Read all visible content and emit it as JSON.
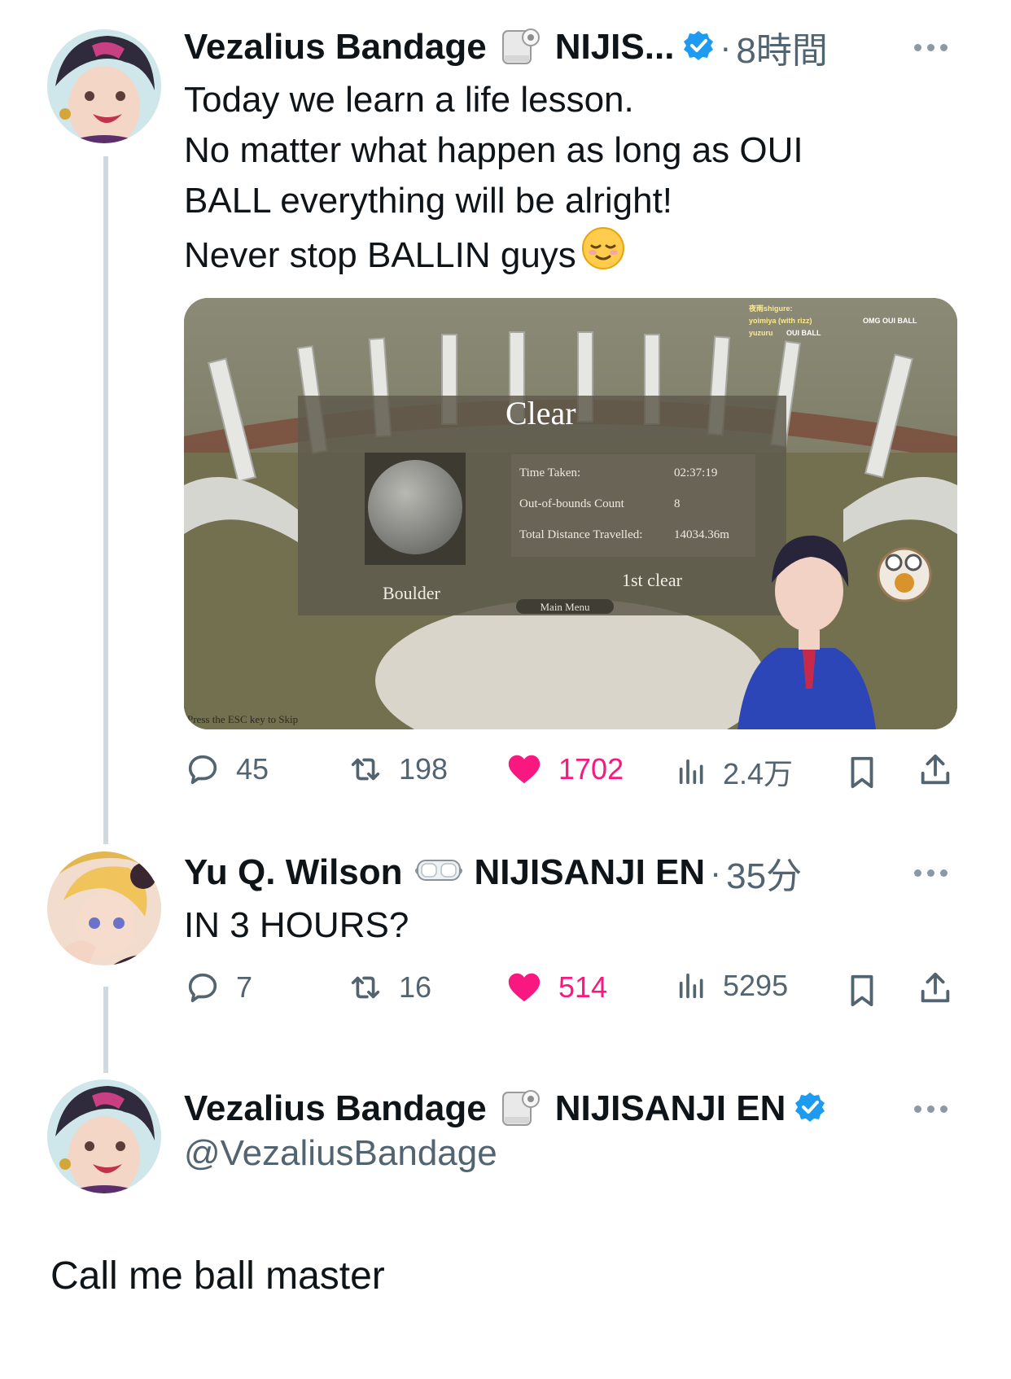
{
  "tweet1": {
    "author_name": "Vezalius Bandage",
    "author_emoji": "toilet-paper-icon",
    "affiliation": "NIJIS...",
    "dot": "·",
    "time": "8時間",
    "text_lines": [
      "Today we learn a life lesson.",
      "No matter what happen as long as OUI",
      "BALL everything will be alright!",
      "Never stop BALLIN guys"
    ],
    "text_emoji": "relieved-face-icon",
    "media": {
      "title": "Clear",
      "stats": [
        {
          "label": "Time Taken:",
          "value": "02:37:19"
        },
        {
          "label": "Out-of-bounds Count",
          "value": "8"
        },
        {
          "label": "Total Distance Travelled:",
          "value": "14034.36m"
        }
      ],
      "ball_label": "Boulder",
      "clear_note": "1st clear",
      "menu_button": "Main Menu",
      "skip_hint": "Press the ESC key to Skip",
      "chat": [
        {
          "user": "夜雨shigure:",
          "msg": ""
        },
        {
          "user": "yoimiya (with rizz)",
          "msg": "OMG OUI BALL"
        },
        {
          "user": "yuzuru",
          "msg": "OUI BALL"
        }
      ]
    },
    "actions": {
      "replies": "45",
      "retweets": "198",
      "likes": "1702",
      "views": "2.4万"
    }
  },
  "tweet2": {
    "author_name": "Yu Q. Wilson",
    "author_emoji": "goggles-icon",
    "affiliation": "NIJISANJI EN",
    "dot": "·",
    "time": "35分",
    "text": "IN 3 HOURS?",
    "actions": {
      "replies": "7",
      "retweets": "16",
      "likes": "514",
      "views": "5295"
    }
  },
  "tweet3": {
    "author_name": "Vezalius Bandage",
    "author_emoji": "toilet-paper-icon",
    "affiliation": "NIJISANJI EN",
    "handle": "@VezaliusBandage",
    "text": "Call me ball master"
  },
  "colors": {
    "like": "#f91880",
    "verified": "#1d9bf0",
    "secondary": "#536471"
  }
}
